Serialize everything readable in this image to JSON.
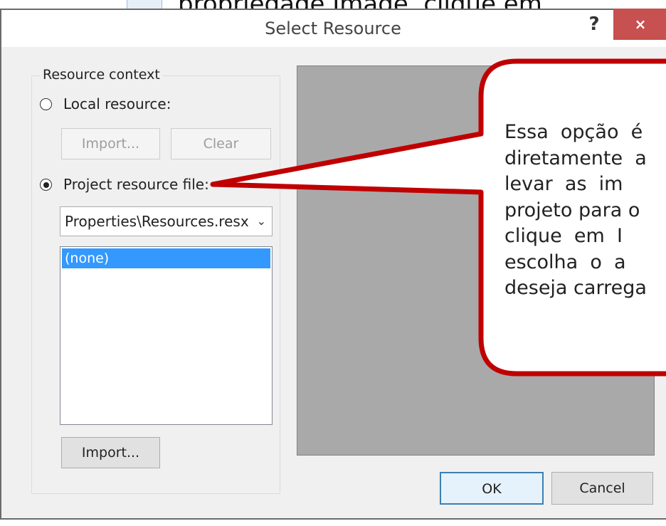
{
  "background": {
    "partial_text": "propriedade Image, clique em"
  },
  "dialog": {
    "title": "Select Resource",
    "help_label": "?",
    "close_label": "×",
    "group_label": "Resource context",
    "local_resource": {
      "label": "Local resource:",
      "checked": false,
      "import_label": "Import...",
      "clear_label": "Clear"
    },
    "project_resource": {
      "label": "Project resource file:",
      "checked": true,
      "file_selected": "Properties\\Resources.resx",
      "list_items": [
        "(none)"
      ],
      "import_label": "Import..."
    },
    "ok_label": "OK",
    "cancel_label": "Cancel"
  },
  "callout": {
    "lines": [
      "Essa  opção  é",
      "diretamente  a",
      "levar  as  im",
      "projeto para o",
      "clique  em  I",
      "escolha  o  a",
      "deseja carrega"
    ],
    "border_color": "#c00000",
    "fill_color": "#ffffff"
  },
  "colors": {
    "close_button": "#c75050",
    "selection": "#3399ff",
    "preview_area": "#a9a9a9"
  }
}
